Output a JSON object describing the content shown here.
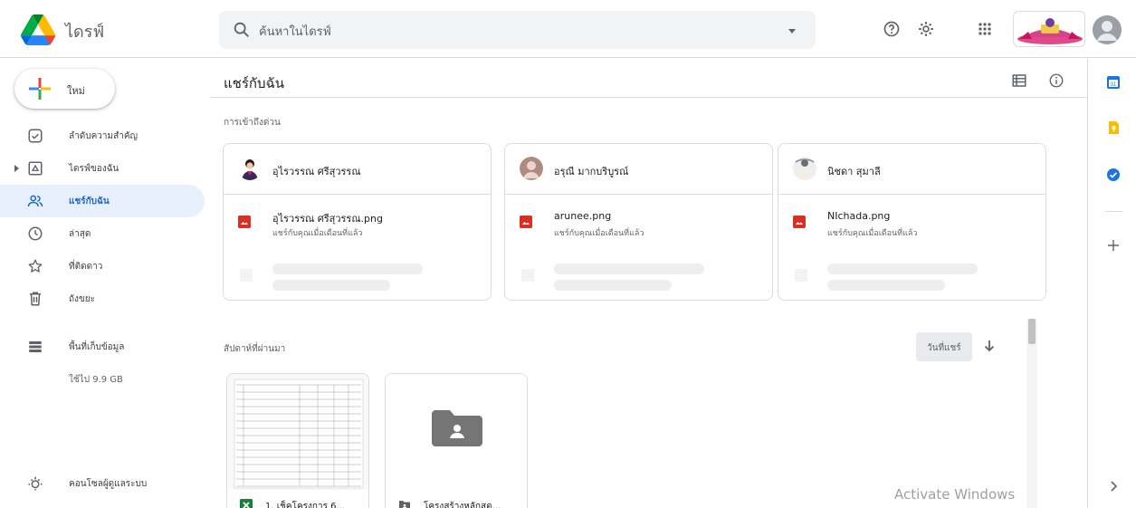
{
  "header": {
    "brand": "ไดรฟ์",
    "search_placeholder": "ค้นหาในไดรฟ์",
    "icons": [
      "drive-logo-icon",
      "search-icon",
      "chevron-down-icon",
      "help-icon",
      "gear-icon",
      "apps-icon"
    ]
  },
  "sidebar": {
    "new_label": "ใหม่",
    "items": [
      {
        "label": "ลำดับความสำคัญ",
        "icon": "priority-icon"
      },
      {
        "label": "ไดรฟ์ของฉัน",
        "icon": "my-drive-icon"
      },
      {
        "label": "แชร์กับฉัน",
        "icon": "shared-icon"
      },
      {
        "label": "ล่าสุด",
        "icon": "clock-icon"
      },
      {
        "label": "ที่ติดดาว",
        "icon": "star-icon"
      },
      {
        "label": "ถังขยะ",
        "icon": "trash-icon"
      },
      {
        "label": "พื้นที่เก็บข้อมูล",
        "icon": "storage-icon"
      },
      {
        "label": "คอนโซลผู้ดูแลระบบ",
        "icon": "admin-icon"
      }
    ],
    "active": "แชร์กับฉัน",
    "storage_used": "ใช้ไป 9.9 GB"
  },
  "main": {
    "title": "แชร์กับฉัน",
    "quick_access_label": "การเข้าถึงด่วน",
    "quick_access": [
      {
        "person": "อุไรวรรณ ศรีสุวรรณ",
        "file": "อุไรวรรณ ศรีสุวรรณ.png",
        "sub": "แชร์กับคุณเมื่อเดือนที่แล้ว"
      },
      {
        "person": "อรุณี มากบริบูรณ์",
        "file": "arunee.png",
        "sub": "แชร์กับคุณเมื่อเดือนที่แล้ว"
      },
      {
        "person": "นิชดา สุมาลี",
        "file": "NIchada.png",
        "sub": "แชร์กับคุณเมื่อเดือนที่แล้ว"
      }
    ],
    "recent_label": "สัปดาห์ที่ผ่านมา",
    "sort_label": "วันที่แชร์",
    "files": [
      {
        "name": "1. เช็คโครงการ 6...",
        "icon": "sheets-icon"
      },
      {
        "name": "โครงสร้างหลักสูต...",
        "icon": "shared-folder-icon"
      }
    ]
  },
  "watermark": "Activate Windows",
  "colors": {
    "accent": "#1967d2",
    "active_bg": "#e8f0fe",
    "image_file": "#d93025",
    "sheets": "#188038",
    "folder": "#5f6368"
  }
}
